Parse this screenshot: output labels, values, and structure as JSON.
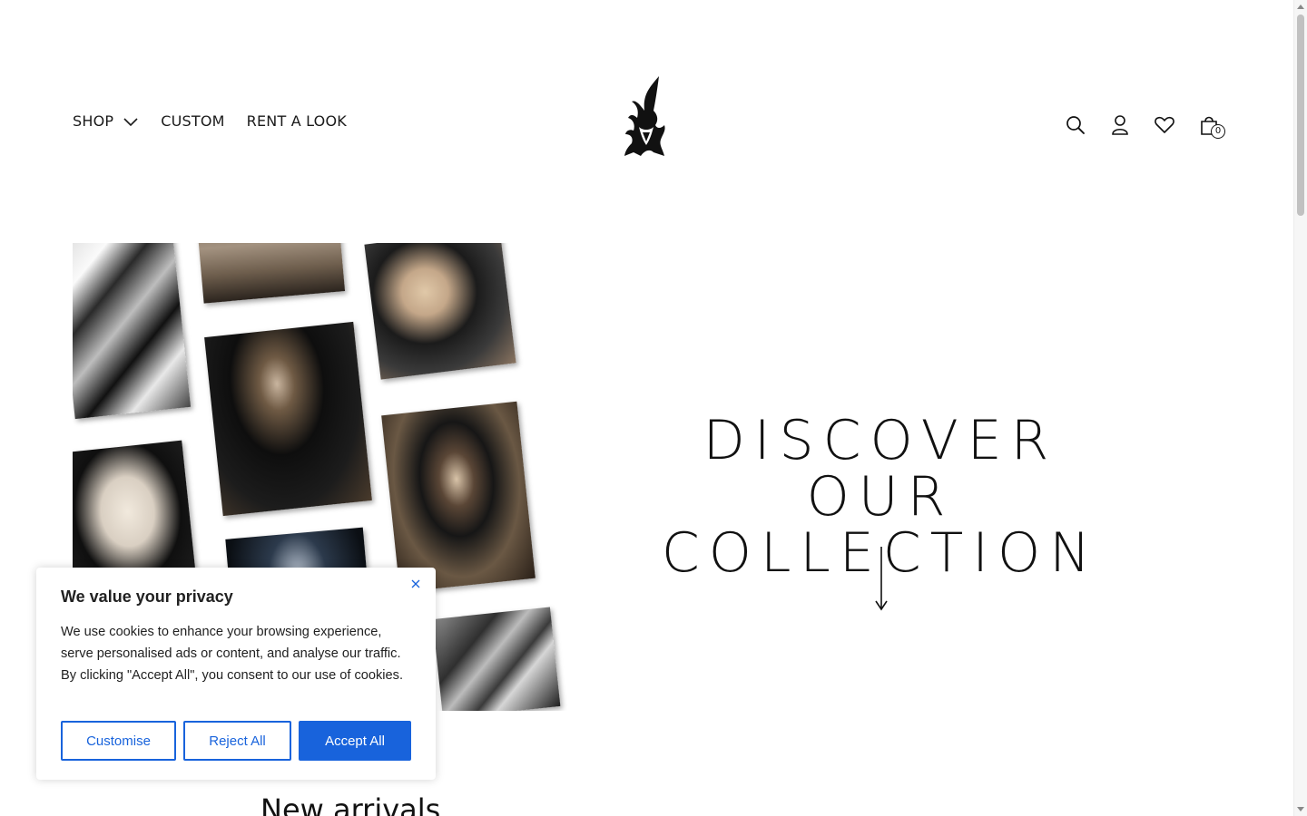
{
  "header": {
    "nav": [
      {
        "label": "SHOP",
        "has_dropdown": true
      },
      {
        "label": "CUSTOM"
      },
      {
        "label": "RENT A LOOK"
      }
    ],
    "icons": [
      "search-icon",
      "account-icon",
      "wishlist-heart-icon",
      "cart-bag-icon"
    ],
    "cart_count": "0"
  },
  "hero": {
    "title_line1": "DISCOVER",
    "title_line2": "OUR COLLECTION"
  },
  "section": {
    "new_arrivals_title": "New arrivals"
  },
  "cookie_banner": {
    "title": "We value your privacy",
    "text": "We use cookies to enhance your browsing experience, serve personalised ads or content, and analyse our traffic. By clicking \"Accept All\", you consent to our use of cookies.",
    "customise_label": "Customise",
    "reject_label": "Reject All",
    "accept_label": "Accept All",
    "accent_color": "#1863dc"
  }
}
